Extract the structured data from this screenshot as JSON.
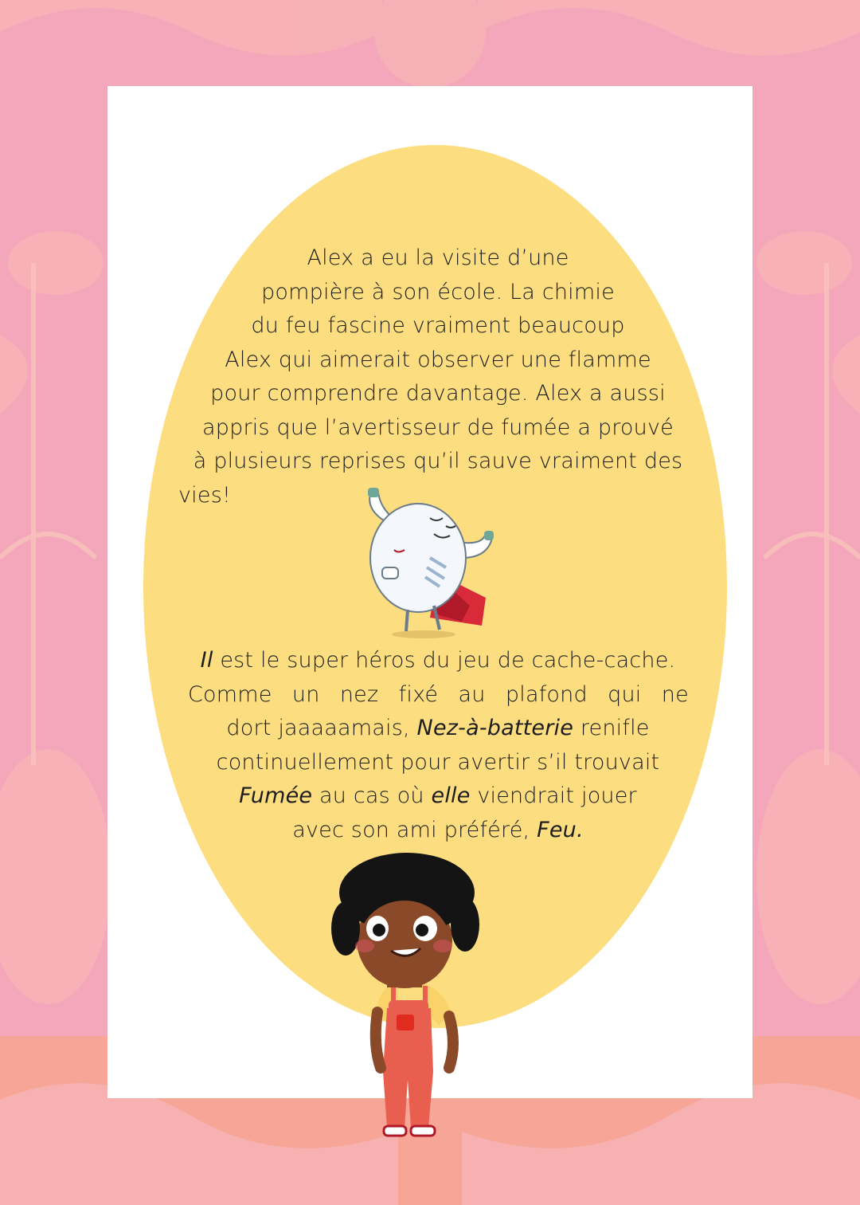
{
  "colors": {
    "background_pink": "#f4a6ba",
    "background_salmon": "#f6a596",
    "oval_yellow": "#fcdd80",
    "card_white": "#ffffff"
  },
  "story": {
    "paragraph1_lines": [
      "Alex a eu la visite d’une",
      "pompière à son école. La chimie",
      "du feu fascine vraiment beaucoup",
      "Alex qui aimerait observer une flamme",
      "pour comprendre davantage. Alex a aussi",
      "appris que l’avertisseur de fumée a prouvé",
      "à plusieurs reprises qu’il sauve vraiment des",
      "vies!"
    ],
    "paragraph2": {
      "l1_italic": "Il",
      "l1_rest": " est le super héros du jeu de cache-cache.",
      "l2_words": [
        "Comme",
        "un",
        "nez",
        "fixé",
        "au",
        "plafond",
        "qui",
        "ne"
      ],
      "l3_start": "dort jaaaaamais, ",
      "l3_italic": "Nez-à-batterie",
      "l3_end": " renifle",
      "l4": "continuellement pour avertir s’il trouvait",
      "l5_italic1": "Fumée",
      "l5_mid": " au cas où ",
      "l5_italic2": "elle",
      "l5_end": " viendrait jouer",
      "l6_start": "avec son ami préféré, ",
      "l6_italic": "Feu."
    }
  },
  "illustrations": {
    "smoke_detector_hero": "smoke-detector-superhero",
    "child": "alex-child-character"
  }
}
